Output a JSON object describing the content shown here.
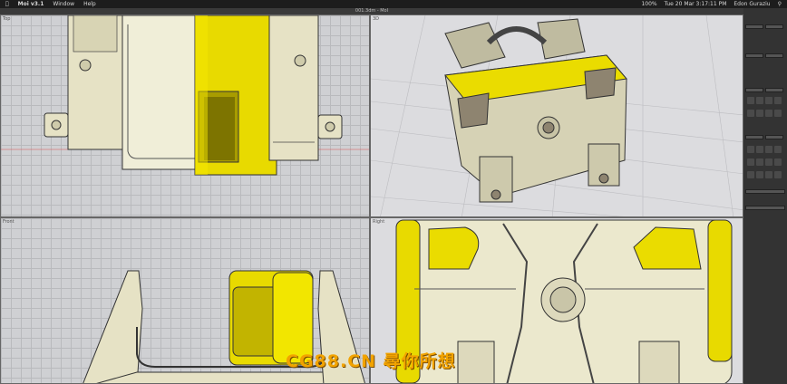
{
  "menubar": {
    "app": "Moi v3.1",
    "window": "Window",
    "help": "Help",
    "battery": "100%",
    "clock": "Tue 20 Mar  3:17:11 PM",
    "user": "Edon Guraziu"
  },
  "window": {
    "title": "001.3dm - MoI"
  },
  "viewports": {
    "top": "Top",
    "persp": "3D",
    "front": "Front",
    "right": "Right"
  },
  "watermark": "CG88.CN 尋你所想",
  "colors": {
    "model": "#e9e6c8",
    "highlight": "#f1e400",
    "accent": "#ff0000"
  }
}
